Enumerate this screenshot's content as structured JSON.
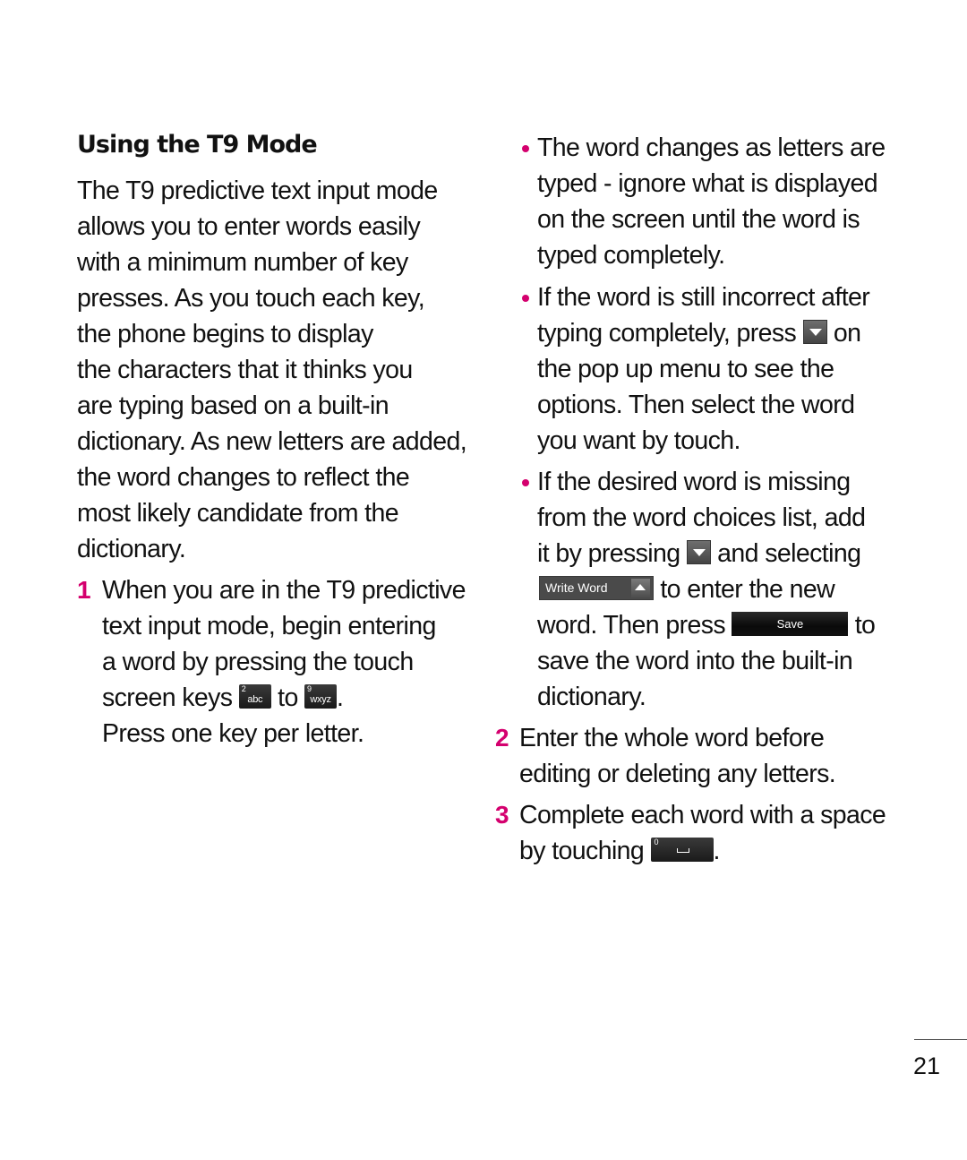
{
  "heading": "Using the T9 Mode",
  "intro_lines": [
    "The T9 predictive text input mode",
    "allows you to enter words easily",
    "with a minimum number of key",
    "presses. As you touch each key,",
    "the phone begins to display",
    "the characters that it thinks you",
    "are typing based on a built-in",
    "dictionary. As new letters are added,",
    "the word changes to reflect the",
    "most likely candidate from the",
    "dictionary."
  ],
  "step1": {
    "number": "1",
    "lines": [
      "When you are in the T9 predictive",
      "text input mode, begin entering",
      "a word by pressing the touch"
    ],
    "line4_before": "screen keys",
    "line4_mid": "to",
    "line4_after": ".",
    "line5": "Press one key per letter.",
    "key_start": {
      "digit": "2",
      "letters": "abc"
    },
    "key_end": {
      "digit": "9",
      "letters": "wxyz"
    }
  },
  "bullets": [
    {
      "lines": [
        "The word changes as letters are",
        "typed - ignore what is displayed",
        "on the screen until the word is",
        "typed completely."
      ]
    },
    {
      "line1": "If the word is still incorrect after",
      "line2_before": "typing completely, press",
      "line2_after": "on",
      "lines_rest": [
        "the pop up menu to see the",
        "options. Then select the word",
        "you want by touch."
      ]
    },
    {
      "line1": "If the desired word is missing",
      "line2": "from the word choices list, add",
      "line3_before": "it by pressing",
      "line3_after": "and selecting",
      "write_word_label": "Write Word",
      "line4_after": "to enter the new",
      "line5_before": "word. Then press",
      "save_label": "Save",
      "line5_after": "to",
      "line6": "save the word into the built-in",
      "line7": "dictionary."
    }
  ],
  "step2": {
    "number": "2",
    "lines": [
      "Enter the whole word before",
      "editing or deleting any letters."
    ]
  },
  "step3": {
    "number": "3",
    "line1": "Complete each word with a space",
    "line2_before": "by touching",
    "line2_after": ".",
    "space_key_digit": "0"
  },
  "page_number": "21",
  "colors": {
    "accent": "#d4006e",
    "text": "#111111",
    "button_dark": "#1a1a1a"
  }
}
